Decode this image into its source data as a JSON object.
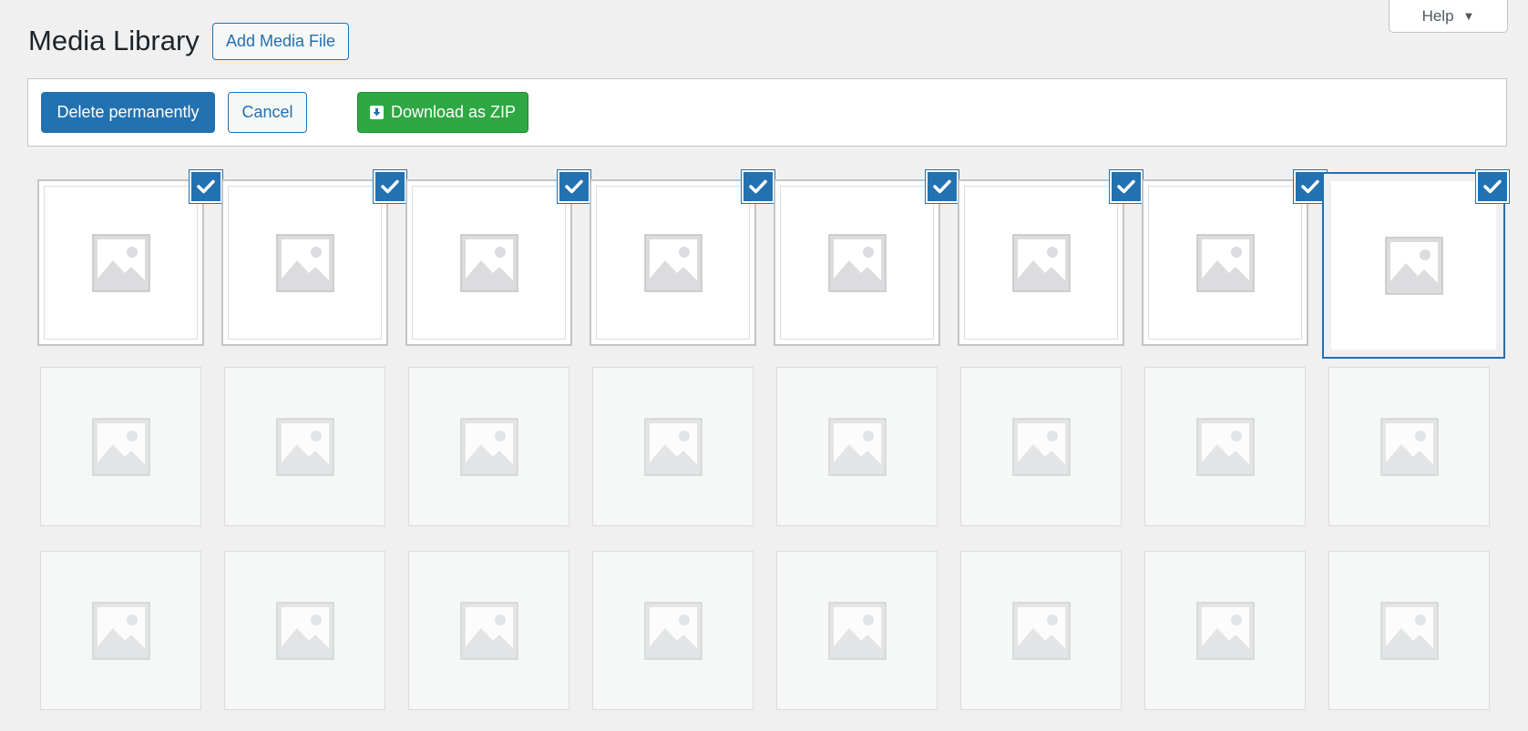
{
  "header": {
    "title": "Media Library",
    "add_button": "Add Media File",
    "help_label": "Help"
  },
  "toolbar": {
    "delete_label": "Delete permanently",
    "cancel_label": "Cancel",
    "download_label": "Download as ZIP"
  },
  "media": {
    "selected_count": 8,
    "total_count": 24,
    "icon": "image-placeholder-icon"
  },
  "colors": {
    "accent": "#2271b1",
    "zip_button": "#2ea843",
    "background": "#f0f0f1"
  }
}
